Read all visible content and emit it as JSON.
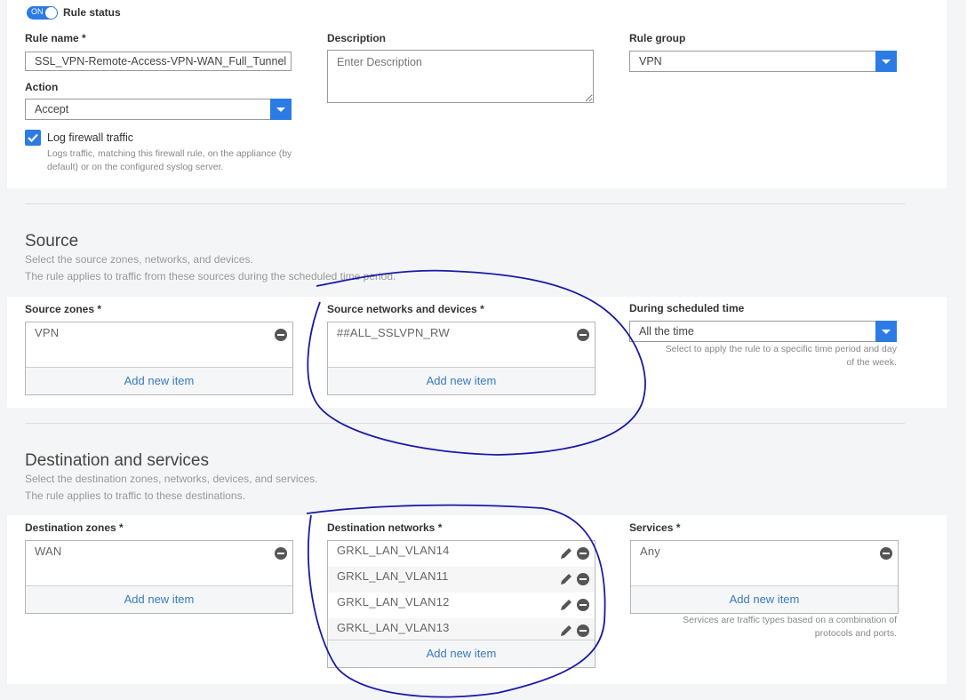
{
  "rule": {
    "status_toggle": "ON",
    "status_label": "Rule status",
    "name_label": "Rule name *",
    "name_value": "SSL_VPN-Remote-Access-VPN-WAN_Full_Tunnel",
    "description_label": "Description",
    "description_placeholder": "Enter Description",
    "group_label": "Rule group",
    "group_value": "VPN",
    "action_label": "Action",
    "action_value": "Accept",
    "log_label": "Log firewall traffic",
    "log_hint": "Logs traffic, matching this firewall rule, on the appliance (by default) or on the configured syslog server."
  },
  "source": {
    "title": "Source",
    "desc1": "Select the source zones, networks, and devices.",
    "desc2": "The rule applies to traffic from these sources during the scheduled time period.",
    "zones_label": "Source zones *",
    "zones_items": [
      "VPN"
    ],
    "networks_label": "Source networks and devices *",
    "networks_items": [
      "##ALL_SSLVPN_RW"
    ],
    "schedule_label": "During scheduled time",
    "schedule_value": "All the time",
    "schedule_hint": "Select to apply the rule to a specific time period and day of the week."
  },
  "destination": {
    "title": "Destination and services",
    "desc1": "Select the destination zones, networks, devices, and services.",
    "desc2": "The rule applies to traffic to these destinations.",
    "zones_label": "Destination zones *",
    "zones_items": [
      "WAN"
    ],
    "networks_label": "Destination networks *",
    "networks_items": [
      "GRKL_LAN_VLAN14",
      "GRKL_LAN_VLAN11",
      "GRKL_LAN_VLAN12",
      "GRKL_LAN_VLAN13"
    ],
    "services_label": "Services *",
    "services_items": [
      "Any"
    ],
    "services_hint": "Services are traffic types based on a combination of protocols and ports."
  },
  "common": {
    "add_new_item": "Add new item"
  },
  "colors": {
    "accent": "#2c7be5",
    "link": "#3a7bbf",
    "annotation": "#1a1aa8"
  }
}
